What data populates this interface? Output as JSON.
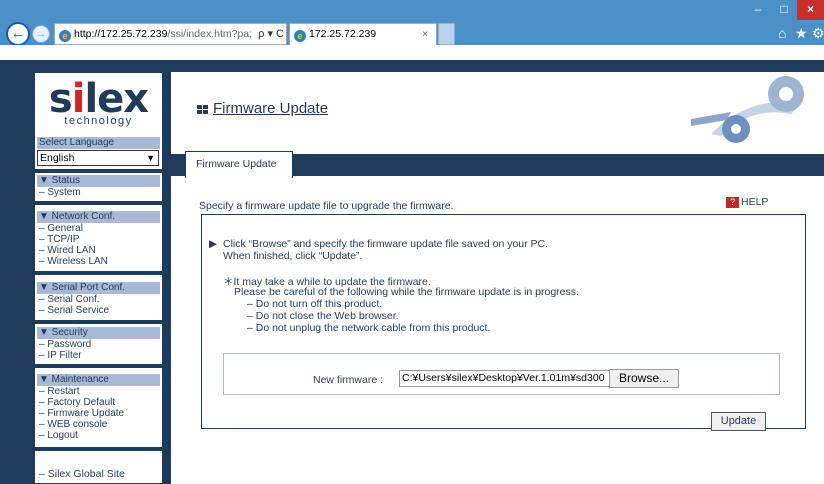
{
  "browser": {
    "address_host": "http://172.25.72.239",
    "address_path": "/ssi/index.htm?pa;",
    "address_controls": "ρ ▾ C",
    "tab_title": "172.25.72.239",
    "tab_close": "×",
    "window_min": "–",
    "window_max": "□",
    "window_close": "×",
    "home_icon": "⌂",
    "star_icon": "★",
    "gear_icon": "⚙",
    "back_arrow": "←",
    "forward_arrow": "→"
  },
  "sidebar": {
    "logo_main_a": "s",
    "logo_main_b": "i",
    "logo_main_c": "lex",
    "logo_sub": "technology",
    "language_header": "Select Language",
    "language_value": "English",
    "status_header": "▼ Status",
    "status_items": [
      "– System"
    ],
    "network_header": "▼ Network Conf.",
    "network_items": [
      "– General",
      "– TCP/IP",
      "– Wired LAN",
      "– Wireless LAN"
    ],
    "serial_header": "▼ Serial Port Conf.",
    "serial_items": [
      "– Serial Conf.",
      "– Serial Service"
    ],
    "security_header": "▼ Security",
    "security_items": [
      "– Password",
      "– IP Filter"
    ],
    "maintenance_header": "▼ Maintenance",
    "maintenance_items": [
      "– Restart",
      "– Factory Default",
      "– Firmware Update",
      "– WEB console",
      "– Logout"
    ],
    "global_site": "– Silex Global Site"
  },
  "main": {
    "title": "Firmware Update",
    "tab_label": "Firmware Update",
    "description": "Specify a firmware update file to upgrade the firmware.",
    "help_label": "HELP",
    "instruction_1": "Click “Browse” and specify the firmware update file saved on your PC.",
    "instruction_2": "When finished, click “Update”.",
    "note_1": "＊It may take a while to update the firmware.",
    "note_2": "Please be careful of the following while the firmware update is in progress.",
    "note_3": "– Do not turn off this product.",
    "note_4": "– Do not close the Web browser.",
    "note_5": "– Do not unplug the network cable from this product.",
    "new_firmware_label": "New firmware :",
    "new_firmware_value": "C:¥Users¥silex¥Desktop¥Ver.1.01m¥sd300",
    "browse_label": "Browse...",
    "update_label": "Update"
  }
}
